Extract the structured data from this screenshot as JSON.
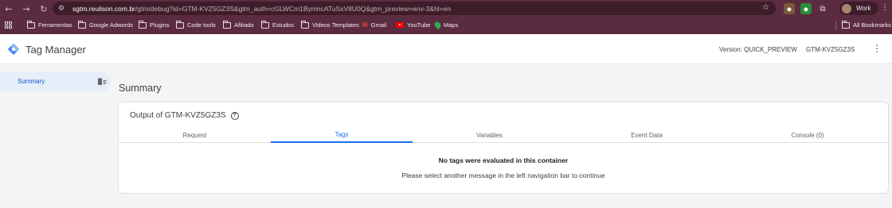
{
  "browser": {
    "url_host": "sgtm.reulison.com.br",
    "url_path": "/gtm/debug?id=GTM-KVZ5GZ3S&gtm_auth=cGLWCm1BymncATuSxV8U0Q&gtm_preview=env-3&hl=en",
    "profile_label": "Work",
    "bookmarks": [
      {
        "label": "Ferramentas",
        "icon": "folder-icon"
      },
      {
        "label": "Google Adwords",
        "icon": "folder-icon"
      },
      {
        "label": "Plugins",
        "icon": "folder-icon"
      },
      {
        "label": "Code tools",
        "icon": "folder-icon"
      },
      {
        "label": "Afiliado",
        "icon": "folder-icon"
      },
      {
        "label": "Estudos",
        "icon": "folder-icon"
      },
      {
        "label": "Videos Templates",
        "icon": "folder-icon"
      },
      {
        "label": "Gmail",
        "icon": "gmail-icon"
      },
      {
        "label": "YouTube",
        "icon": "youtube-icon"
      },
      {
        "label": "Maps",
        "icon": "maps-icon"
      }
    ],
    "all_bookmarks_label": "All Bookmarks"
  },
  "app": {
    "title": "Tag Manager",
    "version": "Version: QUICK_PREVIEW",
    "container_id": "GTM-KVZ5GZ3S",
    "brand_color": "#4285f4",
    "accent_color": "#1a73e8"
  },
  "sidebar": {
    "items": [
      {
        "label": "Summary",
        "icon": "clear-list-icon",
        "selected": true
      }
    ]
  },
  "main": {
    "title": "Summary",
    "card": {
      "title": "Output of GTM-KVZ5GZ3S",
      "tabs": [
        {
          "label": "Request",
          "active": false
        },
        {
          "label": "Tags",
          "active": true
        },
        {
          "label": "Variables",
          "active": false
        },
        {
          "label": "Event Data",
          "active": false
        },
        {
          "label": "Console (0)",
          "active": false
        }
      ],
      "empty_title": "No tags were evaluated in this container",
      "empty_subtitle": "Please select another message in the left navigation bar to continue"
    }
  }
}
